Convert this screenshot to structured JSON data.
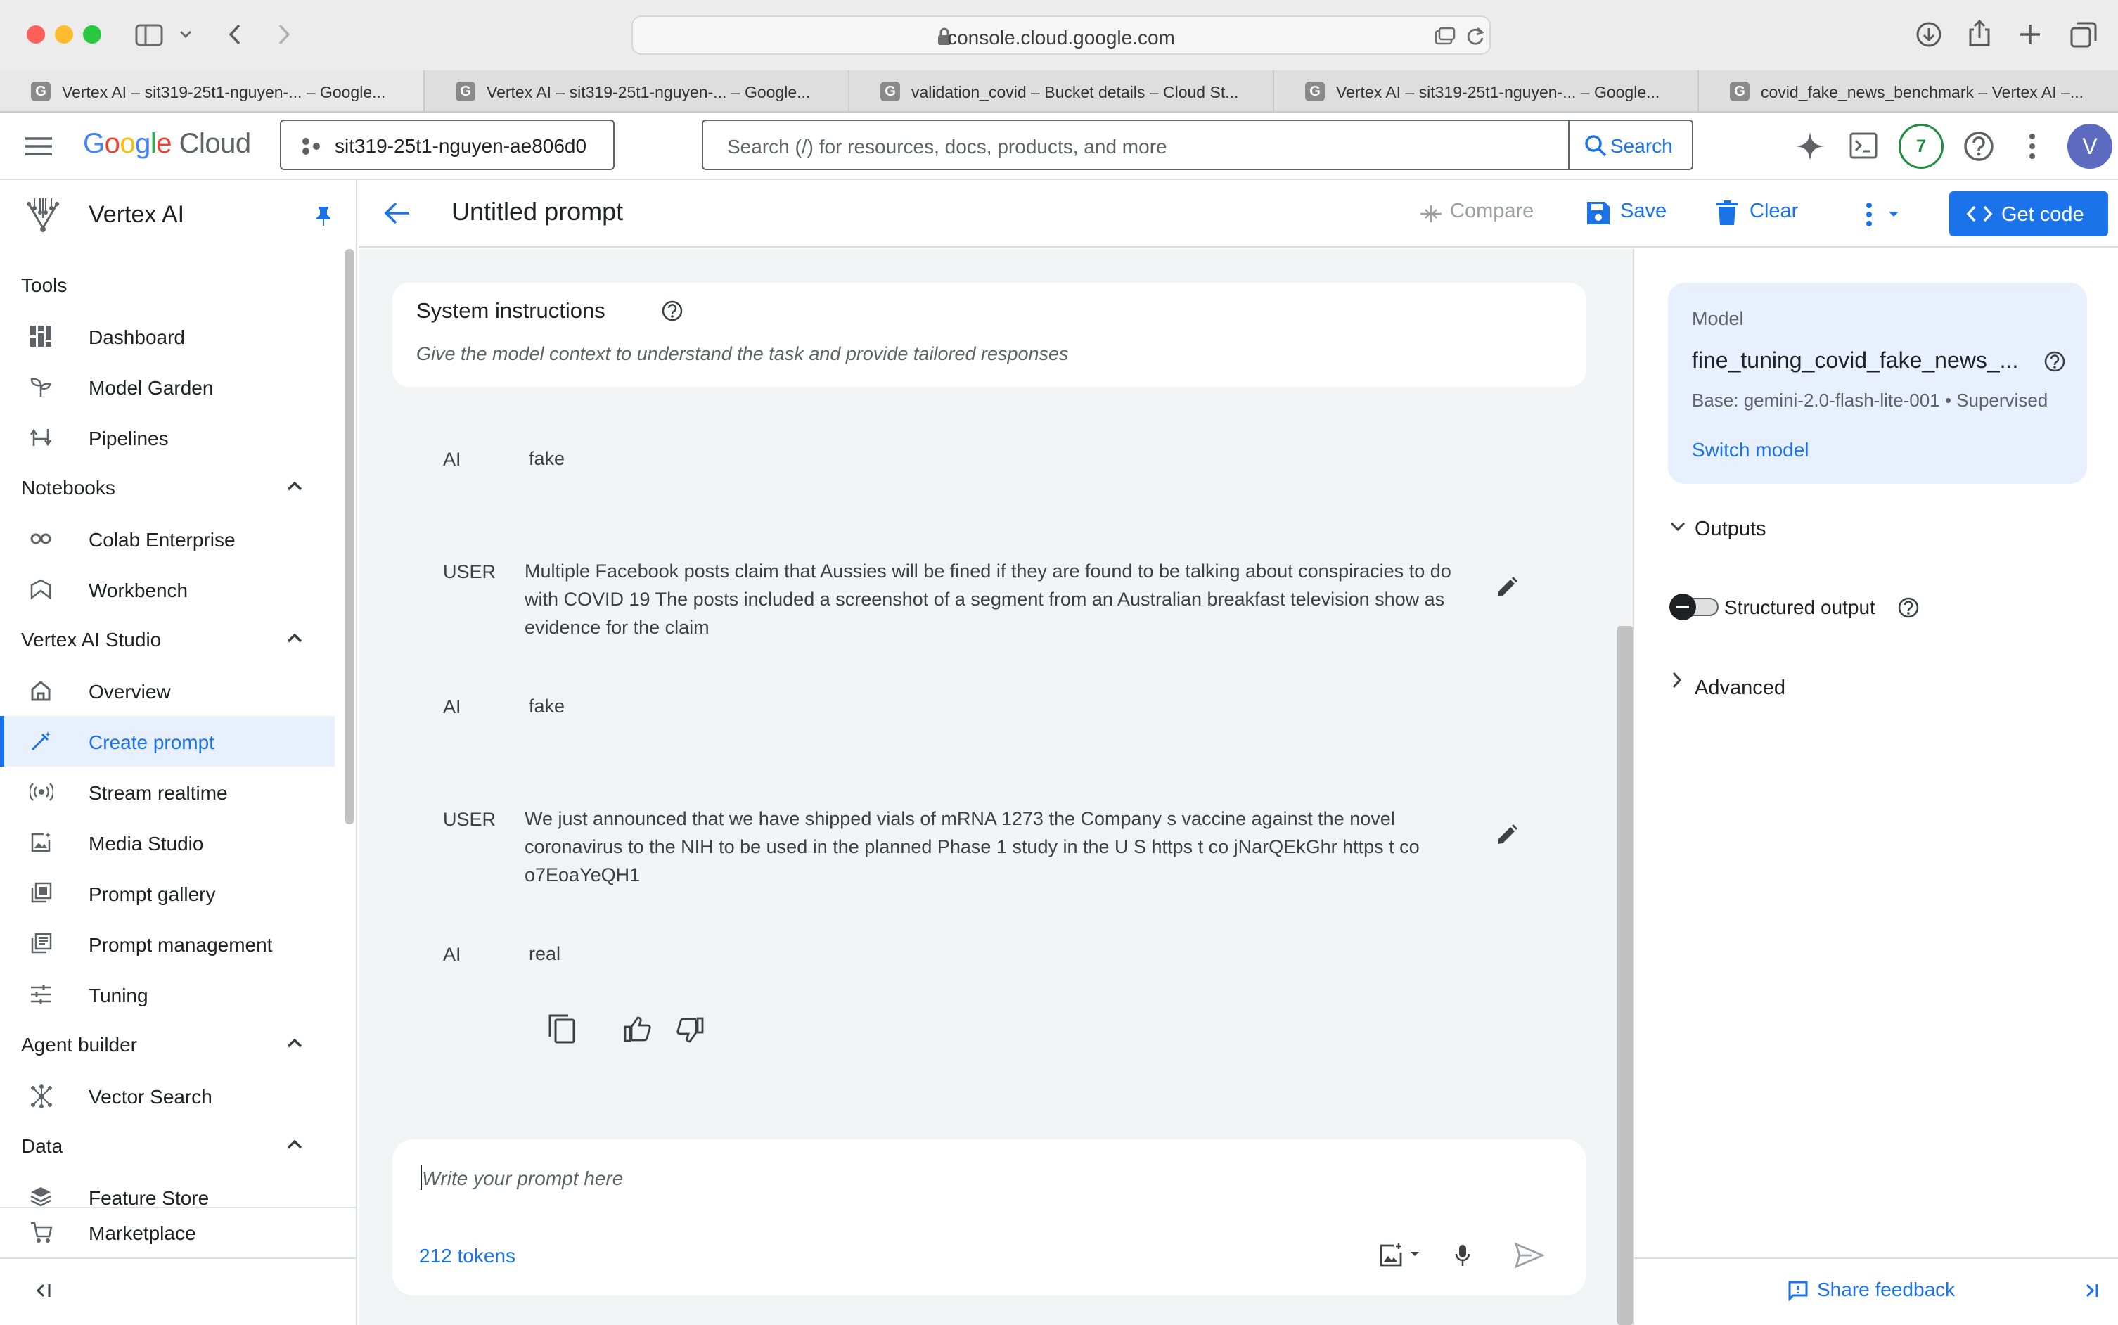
{
  "browser": {
    "url": "console.cloud.google.com",
    "tabs": [
      {
        "title": "Vertex AI – sit319-25t1-nguyen-... – Google..."
      },
      {
        "title": "Vertex AI – sit319-25t1-nguyen-... – Google..."
      },
      {
        "title": "validation_covid – Bucket details – Cloud St..."
      },
      {
        "title": "Vertex AI – sit319-25t1-nguyen-... – Google..."
      },
      {
        "title": "covid_fake_news_benchmark – Vertex AI –..."
      }
    ]
  },
  "topbar": {
    "logo": "Google Cloud",
    "project": "sit319-25t1-nguyen-ae806d0",
    "search_placeholder": "Search (/) for resources, docs, products, and more",
    "search_button": "Search",
    "notification_count": "7",
    "avatar_initial": "V"
  },
  "sidebar": {
    "product": "Vertex AI",
    "sections": {
      "tools": "Tools",
      "notebooks": "Notebooks",
      "studio": "Vertex AI Studio",
      "agent": "Agent builder",
      "data": "Data"
    },
    "items": {
      "dashboard": "Dashboard",
      "model_garden": "Model Garden",
      "pipelines": "Pipelines",
      "colab": "Colab Enterprise",
      "workbench": "Workbench",
      "overview": "Overview",
      "create_prompt": "Create prompt",
      "stream": "Stream realtime",
      "media": "Media Studio",
      "gallery": "Prompt gallery",
      "management": "Prompt management",
      "tuning": "Tuning",
      "vector": "Vector Search",
      "feature_store": "Feature Store",
      "marketplace": "Marketplace"
    }
  },
  "header": {
    "title": "Untitled prompt",
    "compare": "Compare",
    "save": "Save",
    "clear": "Clear",
    "get_code": "Get code"
  },
  "system_instructions": {
    "title": "System instructions",
    "placeholder": "Give the model context to understand the task and provide tailored responses"
  },
  "conversation": [
    {
      "role": "AI",
      "text": "fake"
    },
    {
      "role": "USER",
      "text": "Multiple Facebook posts claim that Aussies will be fined if they are found to be talking about conspiracies to do with COVID 19 The posts included a screenshot of a segment from an Australian breakfast television show as evidence for the claim"
    },
    {
      "role": "AI",
      "text": "fake"
    },
    {
      "role": "USER",
      "text": "We just announced that we have shipped vials of mRNA 1273 the Company s vaccine against the novel coronavirus to the NIH to be used in the planned Phase 1 study in the U S https t co jNarQEkGhr https t co o7EoaYeQH1"
    },
    {
      "role": "AI",
      "text": "real"
    }
  ],
  "composer": {
    "placeholder": "Write your prompt here",
    "tokens": "212 tokens"
  },
  "model_panel": {
    "label": "Model",
    "name": "fine_tuning_covid_fake_news_...",
    "base": "Base: gemini-2.0-flash-lite-001 • Supervised",
    "switch": "Switch model",
    "outputs": "Outputs",
    "structured_output": "Structured output",
    "structured_output_on": false,
    "advanced": "Advanced",
    "feedback": "Share feedback"
  },
  "colors": {
    "accent": "#1a73e8",
    "selected_bg": "#e8f0fe",
    "main_bg": "#f1f3f4"
  }
}
